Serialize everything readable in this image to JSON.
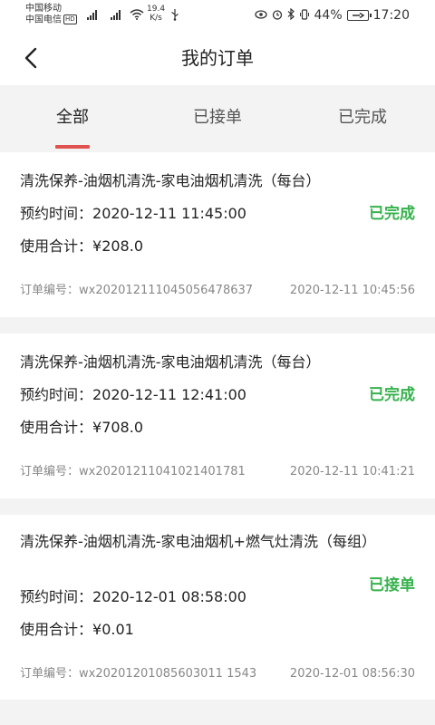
{
  "status_bar": {
    "carrier1": "中国移动",
    "carrier2": "中国电信",
    "hd": "HD",
    "speed_value": "19.4",
    "speed_unit": "K/s",
    "battery": "44%",
    "time": "17:20"
  },
  "header": {
    "title": "我的订单"
  },
  "tabs": [
    {
      "label": "全部",
      "active": true
    },
    {
      "label": "已接单",
      "active": false
    },
    {
      "label": "已完成",
      "active": false
    }
  ],
  "orders": [
    {
      "title": "清洗保养-油烟机清洗-家电油烟机清洗（每台）",
      "time_label": "预约时间：",
      "time": "2020-12-11 11:45:00",
      "total_label": "使用合计：",
      "total": "¥208.0",
      "status": "已完成",
      "no_label": "订单编号：",
      "order_no": "wx2020121110450564786​37",
      "created": "2020-12-11 10:45:56"
    },
    {
      "title": "清洗保养-油烟机清洗-家电油烟机清洗（每台）",
      "time_label": "预约时间：",
      "time": "2020-12-11 12:41:00",
      "total_label": "使用合计：",
      "total": "¥708.0",
      "status": "已完成",
      "no_label": "订单编号：",
      "order_no": "wx20201211041021401781",
      "created": "2020-12-11 10:41:21"
    },
    {
      "title": "清洗保养-油烟机清洗-家电油烟机+燃气灶清洗（每组）",
      "time_label": "预约时间：",
      "time": "2020-12-01 08:58:00",
      "total_label": "使用合计：",
      "total": "¥0.01",
      "status": "已接单",
      "no_label": "订单编号：",
      "order_no": "wx20201201085603011 1543",
      "created": "2020-12-01 08:56:30"
    }
  ],
  "colors": {
    "accent": "#e0524f",
    "status_green": "#37b24d",
    "background": "#f3f3f3"
  }
}
